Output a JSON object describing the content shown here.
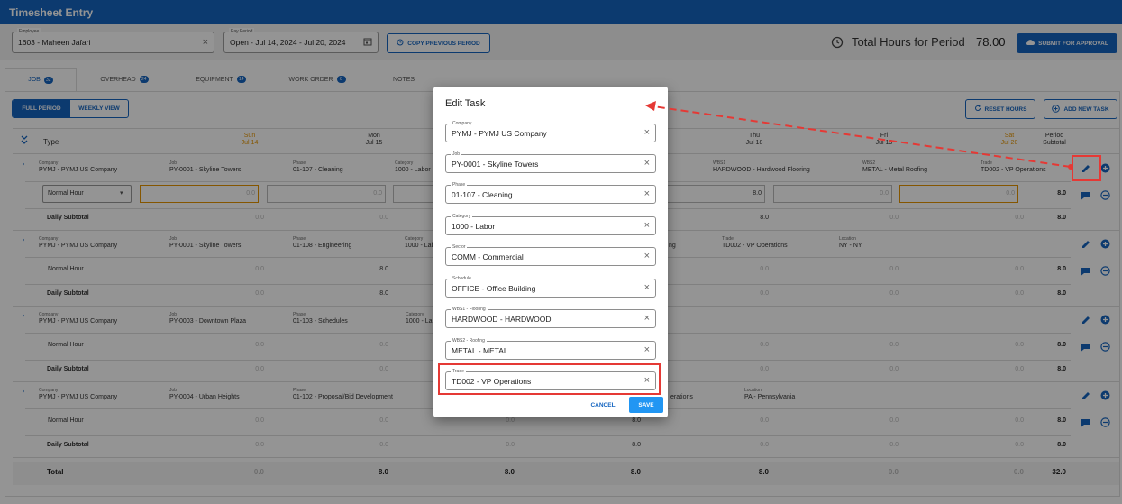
{
  "app_title": "Timesheet Entry",
  "filters": {
    "employee_label": "Employee",
    "employee_value": "1603 - Maheen Jafari",
    "pay_period_label": "Pay Period",
    "pay_period_value": "Open - Jul 14, 2024 - Jul 20, 2024",
    "copy_previous": "COPY PREVIOUS PERIOD",
    "total_hours_label": "Total Hours for Period",
    "total_hours_value": "78.00",
    "submit": "SUBMIT FOR APPROVAL"
  },
  "tabs": [
    {
      "label": "JOB",
      "count": "32"
    },
    {
      "label": "OVERHEAD",
      "count": "24"
    },
    {
      "label": "EQUIPMENT",
      "count": "14"
    },
    {
      "label": "WORK ORDER",
      "count": "8"
    },
    {
      "label": "NOTES",
      "count": ""
    }
  ],
  "view_toggle": {
    "full_period": "FULL PERIOD",
    "weekly_view": "WEEKLY VIEW"
  },
  "actions": {
    "reset_hours": "RESET HOURS",
    "add_new_task": "ADD NEW TASK"
  },
  "grid": {
    "type_header": "Type",
    "days": [
      {
        "name": "Sun",
        "date": "Jul 14",
        "weekend": true
      },
      {
        "name": "Mon",
        "date": "Jul 15",
        "weekend": false
      },
      {
        "name": "Tue",
        "date": "Jul 16",
        "weekend": false
      },
      {
        "name": "Wed",
        "date": "Jul 17",
        "weekend": false
      },
      {
        "name": "Thu",
        "date": "Jul 18",
        "weekend": false
      },
      {
        "name": "Fri",
        "date": "Jul 19",
        "weekend": false
      },
      {
        "name": "Sat",
        "date": "Jul 20",
        "weekend": true
      }
    ],
    "period_subtotal_l1": "Period",
    "period_subtotal_l2": "Subtotal",
    "labels": {
      "company": "Company",
      "job": "Job",
      "phase": "Phase",
      "category": "Category",
      "wbs1": "WBS1",
      "wbs2": "WBS2",
      "trade": "Trade",
      "location": "Location"
    },
    "zero": "0.0",
    "normal_hour": "Normal Hour",
    "daily_subtotal": "Daily Subtotal",
    "total": "Total",
    "blocks": [
      {
        "company": "PYMJ - PYMJ US Company",
        "job": "PY-0001 - Skyline Towers",
        "phase": "01-107 - Cleaning",
        "category": "1000 - Labor",
        "wbs1": "HARDWOOD - Hardwood Flooring",
        "wbs2": "METAL - Metal Roofing",
        "trade": "TD002 - VP Operations",
        "hours": [
          "0.0",
          "0.0",
          "0.0",
          "0.0",
          "8.0",
          "0.0",
          "0.0"
        ],
        "row_total": "8.0",
        "daily": [
          "0.0",
          "0.0",
          "0.0",
          "0.0",
          "8.0",
          "0.0",
          "0.0"
        ],
        "daily_total": "8.0"
      },
      {
        "company": "PYMJ - PYMJ US Company",
        "job": "PY-0001 - Skyline Towers",
        "phase": "01-108 - Engineering",
        "category": "1000 - Labor",
        "trade_partial": "ng",
        "trade": "TD002 - VP Operations",
        "location": "NY - NY",
        "hours": [
          "0.0",
          "8.0",
          "0.0",
          "0.0",
          "0.0",
          "0.0",
          "0.0"
        ],
        "row_total": "8.0",
        "daily": [
          "0.0",
          "8.0",
          "0.0",
          "0.0",
          "0.0",
          "0.0",
          "0.0"
        ],
        "daily_total": "8.0"
      },
      {
        "company": "PYMJ - PYMJ US Company",
        "job": "PY-0003 - Downtown Plaza",
        "phase": "01-103 - Schedules",
        "category": "1000 - Labor",
        "hours": [
          "0.0",
          "0.0",
          "0.0",
          "0.0",
          "0.0",
          "0.0",
          "0.0"
        ],
        "row_total": "8.0",
        "daily": [
          "0.0",
          "0.0",
          "0.0",
          "0.0",
          "0.0",
          "0.0",
          "0.0"
        ],
        "daily_total": "8.0"
      },
      {
        "company": "PYMJ - PYMJ US Company",
        "job": "PY-0004 - Urban Heights",
        "phase": "01-102 - Proposal/Bid Development",
        "trade_partial": "erations",
        "location": "PA - Pennsylvania",
        "hours": [
          "0.0",
          "0.0",
          "0.0",
          "8.0",
          "0.0",
          "0.0",
          "0.0"
        ],
        "row_total": "8.0",
        "daily": [
          "0.0",
          "0.0",
          "0.0",
          "8.0",
          "0.0",
          "0.0",
          "0.0"
        ],
        "daily_total": "8.0"
      }
    ],
    "totals": [
      "0.0",
      "8.0",
      "8.0",
      "8.0",
      "8.0",
      "0.0",
      "0.0"
    ],
    "grand_total": "32.0"
  },
  "modal": {
    "title": "Edit Task",
    "fields": [
      {
        "label": "Company",
        "value": "PYMJ - PYMJ US Company"
      },
      {
        "label": "Job",
        "value": "PY-0001 - Skyline Towers"
      },
      {
        "label": "Phase",
        "value": "01-107 - Cleaning"
      },
      {
        "label": "Category",
        "value": "1000 - Labor"
      },
      {
        "label": "Sector",
        "value": "COMM - Commercial"
      },
      {
        "label": "Schedule",
        "value": "OFFICE - Office Building"
      },
      {
        "label": "WBS1 - Flooring",
        "value": "HARDWOOD - HARDWOOD"
      },
      {
        "label": "WBS2 - Roofing",
        "value": "METAL - METAL"
      },
      {
        "label": "Trade",
        "value": "TD002 - VP Operations"
      }
    ],
    "cancel": "CANCEL",
    "save": "SAVE"
  },
  "colors": {
    "primary": "#1565c0",
    "weekend": "#e69500",
    "highlight": "#e53935"
  }
}
